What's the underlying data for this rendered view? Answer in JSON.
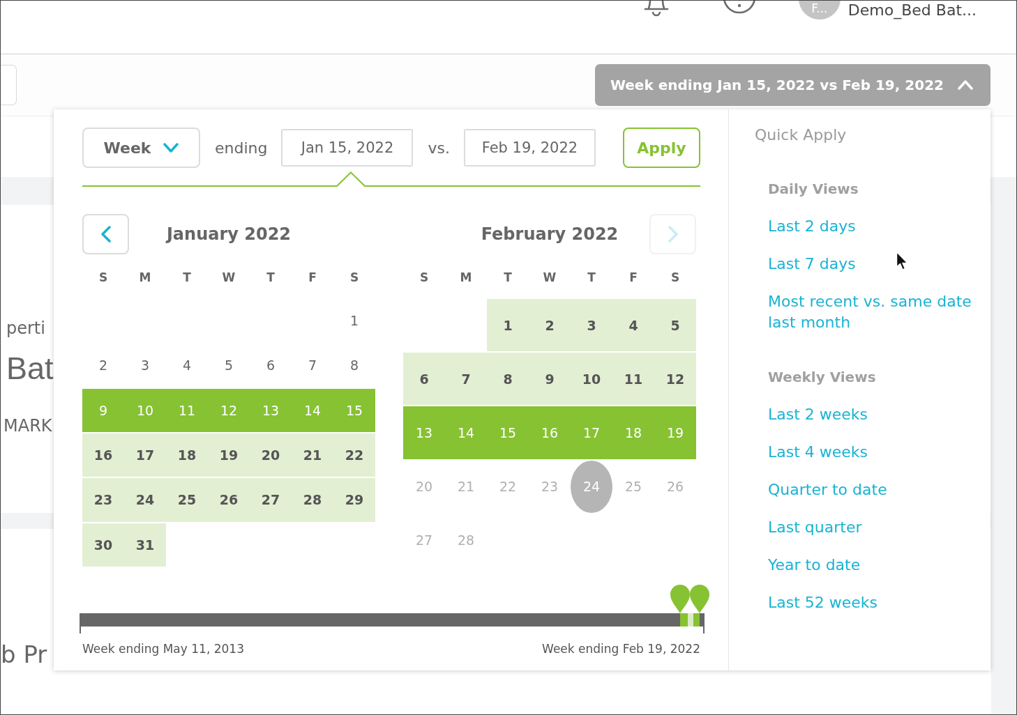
{
  "header": {
    "avatar_initials": "F...",
    "user_name": "Demo_Bed Bat..."
  },
  "date_range_button": {
    "label": "Week ending Jan 15, 2022 vs Feb 19, 2022",
    "expanded": true
  },
  "page_behind": {
    "cards": [
      {
        "texts": [
          {
            "kind": "label",
            "text": "perti"
          },
          {
            "kind": "title",
            "text": "Bat"
          },
          {
            "kind": "label",
            "text": "MARK"
          }
        ]
      },
      {
        "texts": [
          {
            "kind": "heading",
            "text": "b Pr"
          }
        ]
      }
    ]
  },
  "date_picker": {
    "period_select": {
      "value": "Week"
    },
    "ending_label": "ending",
    "vs_label": "vs.",
    "date_fields": [
      {
        "value": "Jan 15, 2022",
        "selected": true
      },
      {
        "value": "Feb 19, 2022",
        "selected": false
      }
    ],
    "apply_button": "Apply",
    "months": [
      {
        "title": "January 2022",
        "nav_button": {
          "kind": "prev",
          "disabled": false
        },
        "weekdays": [
          "S",
          "M",
          "T",
          "W",
          "T",
          "F",
          "S"
        ],
        "weeks": [
          [
            {
              "day": "1",
              "selected": false,
              "in_range": false,
              "disabled": false,
              "today": false
            }
          ],
          [
            {
              "day": "2",
              "selected": false,
              "in_range": false,
              "disabled": false,
              "today": false
            },
            {
              "day": "3",
              "selected": false,
              "in_range": false,
              "disabled": false,
              "today": false
            },
            {
              "day": "4",
              "selected": false,
              "in_range": false,
              "disabled": false,
              "today": false
            },
            {
              "day": "5",
              "selected": false,
              "in_range": false,
              "disabled": false,
              "today": false
            },
            {
              "day": "6",
              "selected": false,
              "in_range": false,
              "disabled": false,
              "today": false
            },
            {
              "day": "7",
              "selected": false,
              "in_range": false,
              "disabled": false,
              "today": false
            },
            {
              "day": "8",
              "selected": false,
              "in_range": false,
              "disabled": false,
              "today": false
            }
          ],
          [
            {
              "day": "9",
              "selected": true,
              "in_range": false,
              "disabled": false,
              "today": false
            },
            {
              "day": "10",
              "selected": true,
              "in_range": false,
              "disabled": false,
              "today": false
            },
            {
              "day": "11",
              "selected": true,
              "in_range": false,
              "disabled": false,
              "today": false
            },
            {
              "day": "12",
              "selected": true,
              "in_range": false,
              "disabled": false,
              "today": false
            },
            {
              "day": "13",
              "selected": true,
              "in_range": false,
              "disabled": false,
              "today": false
            },
            {
              "day": "14",
              "selected": true,
              "in_range": false,
              "disabled": false,
              "today": false
            },
            {
              "day": "15",
              "selected": true,
              "in_range": false,
              "disabled": false,
              "today": false
            }
          ],
          [
            {
              "day": "16",
              "selected": false,
              "in_range": true,
              "disabled": false,
              "today": false
            },
            {
              "day": "17",
              "selected": false,
              "in_range": true,
              "disabled": false,
              "today": false
            },
            {
              "day": "18",
              "selected": false,
              "in_range": true,
              "disabled": false,
              "today": false
            },
            {
              "day": "19",
              "selected": false,
              "in_range": true,
              "disabled": false,
              "today": false
            },
            {
              "day": "20",
              "selected": false,
              "in_range": true,
              "disabled": false,
              "today": false
            },
            {
              "day": "21",
              "selected": false,
              "in_range": true,
              "disabled": false,
              "today": false
            },
            {
              "day": "22",
              "selected": false,
              "in_range": true,
              "disabled": false,
              "today": false
            }
          ],
          [
            {
              "day": "23",
              "selected": false,
              "in_range": true,
              "disabled": false,
              "today": false
            },
            {
              "day": "24",
              "selected": false,
              "in_range": true,
              "disabled": false,
              "today": false
            },
            {
              "day": "25",
              "selected": false,
              "in_range": true,
              "disabled": false,
              "today": false
            },
            {
              "day": "26",
              "selected": false,
              "in_range": true,
              "disabled": false,
              "today": false
            },
            {
              "day": "27",
              "selected": false,
              "in_range": true,
              "disabled": false,
              "today": false
            },
            {
              "day": "28",
              "selected": false,
              "in_range": true,
              "disabled": false,
              "today": false
            },
            {
              "day": "29",
              "selected": false,
              "in_range": true,
              "disabled": false,
              "today": false
            }
          ],
          [
            {
              "day": "30",
              "selected": false,
              "in_range": true,
              "disabled": false,
              "today": false
            },
            {
              "day": "31",
              "selected": false,
              "in_range": true,
              "disabled": false,
              "today": false
            }
          ]
        ]
      },
      {
        "title": "February 2022",
        "nav_button": {
          "kind": "next",
          "disabled": true
        },
        "weekdays": [
          "S",
          "M",
          "T",
          "W",
          "T",
          "F",
          "S"
        ],
        "weeks": [
          [
            {
              "day": "1",
              "selected": false,
              "in_range": true,
              "disabled": false,
              "today": false
            },
            {
              "day": "2",
              "selected": false,
              "in_range": true,
              "disabled": false,
              "today": false
            },
            {
              "day": "3",
              "selected": false,
              "in_range": true,
              "disabled": false,
              "today": false
            },
            {
              "day": "4",
              "selected": false,
              "in_range": true,
              "disabled": false,
              "today": false
            },
            {
              "day": "5",
              "selected": false,
              "in_range": true,
              "disabled": false,
              "today": false
            }
          ],
          [
            {
              "day": "6",
              "selected": false,
              "in_range": true,
              "disabled": false,
              "today": false
            },
            {
              "day": "7",
              "selected": false,
              "in_range": true,
              "disabled": false,
              "today": false
            },
            {
              "day": "8",
              "selected": false,
              "in_range": true,
              "disabled": false,
              "today": false
            },
            {
              "day": "9",
              "selected": false,
              "in_range": true,
              "disabled": false,
              "today": false
            },
            {
              "day": "10",
              "selected": false,
              "in_range": true,
              "disabled": false,
              "today": false
            },
            {
              "day": "11",
              "selected": false,
              "in_range": true,
              "disabled": false,
              "today": false
            },
            {
              "day": "12",
              "selected": false,
              "in_range": true,
              "disabled": false,
              "today": false
            }
          ],
          [
            {
              "day": "13",
              "selected": true,
              "in_range": false,
              "disabled": false,
              "today": false
            },
            {
              "day": "14",
              "selected": true,
              "in_range": false,
              "disabled": false,
              "today": false
            },
            {
              "day": "15",
              "selected": true,
              "in_range": false,
              "disabled": false,
              "today": false
            },
            {
              "day": "16",
              "selected": true,
              "in_range": false,
              "disabled": false,
              "today": false
            },
            {
              "day": "17",
              "selected": true,
              "in_range": false,
              "disabled": false,
              "today": false
            },
            {
              "day": "18",
              "selected": true,
              "in_range": false,
              "disabled": false,
              "today": false
            },
            {
              "day": "19",
              "selected": true,
              "in_range": false,
              "disabled": false,
              "today": false
            }
          ],
          [
            {
              "day": "20",
              "selected": false,
              "in_range": false,
              "disabled": true,
              "today": false
            },
            {
              "day": "21",
              "selected": false,
              "in_range": false,
              "disabled": true,
              "today": false
            },
            {
              "day": "22",
              "selected": false,
              "in_range": false,
              "disabled": true,
              "today": false
            },
            {
              "day": "23",
              "selected": false,
              "in_range": false,
              "disabled": true,
              "today": false
            },
            {
              "day": "24",
              "selected": false,
              "in_range": false,
              "disabled": true,
              "today": true
            },
            {
              "day": "25",
              "selected": false,
              "in_range": false,
              "disabled": true,
              "today": false
            },
            {
              "day": "26",
              "selected": false,
              "in_range": false,
              "disabled": true,
              "today": false
            }
          ],
          [
            {
              "day": "27",
              "selected": false,
              "in_range": false,
              "disabled": true,
              "today": false
            },
            {
              "day": "28",
              "selected": false,
              "in_range": false,
              "disabled": true,
              "today": false
            }
          ]
        ]
      }
    ],
    "timeline": {
      "handles": [
        {
          "level": 0.961
        },
        {
          "level": 0.992
        }
      ],
      "start_label": "Week ending May 11, 2013",
      "end_label": "Week ending Feb 19, 2022"
    }
  },
  "quick_apply": {
    "title": "Quick Apply",
    "groups": [
      {
        "heading": "Daily Views",
        "links": [
          "Last 2 days",
          "Last 7 days",
          "Most recent vs. same date last month"
        ]
      },
      {
        "heading": "Weekly Views",
        "links": [
          "Last 2 weeks",
          "Last 4 weeks",
          "Quarter to date",
          "Last quarter",
          "Year to date",
          "Last 52 weeks"
        ]
      }
    ]
  }
}
